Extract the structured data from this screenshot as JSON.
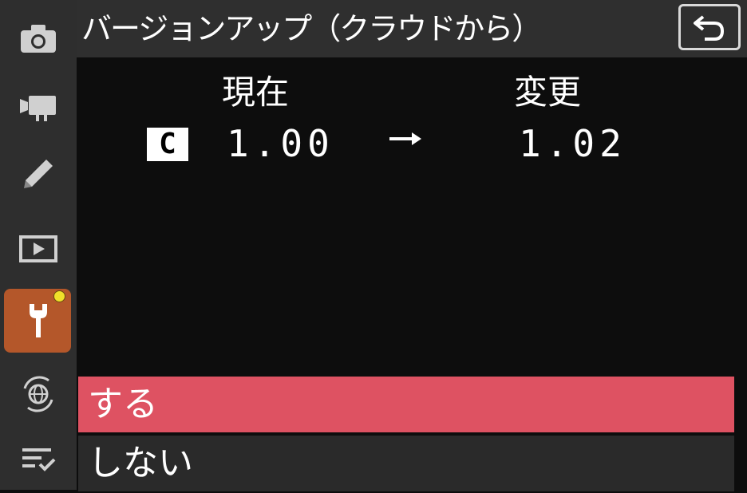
{
  "header": {
    "title": "バージョンアップ（クラウドから）",
    "back_icon": "return-arrow-icon"
  },
  "sidebar": {
    "items": [
      {
        "icon": "camera-icon"
      },
      {
        "icon": "movie-camera-icon"
      },
      {
        "icon": "pencil-icon"
      },
      {
        "icon": "playback-icon"
      },
      {
        "icon": "wrench-icon",
        "active": true,
        "notification": true
      },
      {
        "icon": "network-globe-icon"
      },
      {
        "icon": "my-menu-icon"
      }
    ]
  },
  "version": {
    "current_label": "現在",
    "new_label": "変更",
    "slot": "C",
    "current": "1.00",
    "new": "1.02"
  },
  "options": [
    {
      "label": "する",
      "selected": true
    },
    {
      "label": "しない",
      "selected": false
    }
  ],
  "colors": {
    "accent_active": "#b4572a",
    "selected_option": "#de5262",
    "notification_dot": "#f0e02a"
  }
}
